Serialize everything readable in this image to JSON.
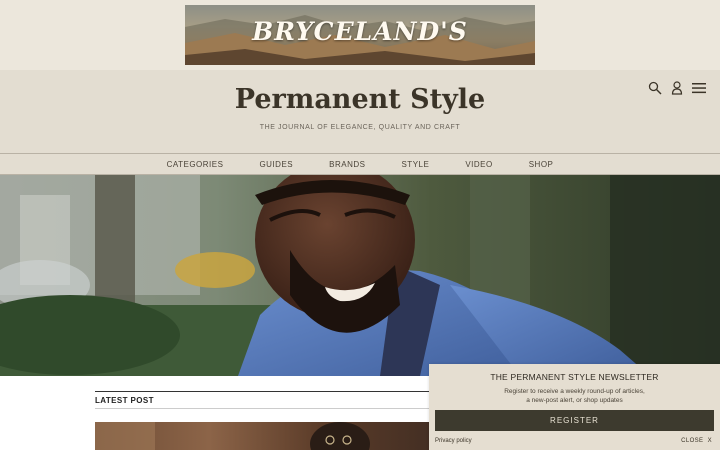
{
  "ad": {
    "brand_logo": "BRYCELAND'S"
  },
  "header": {
    "site_title": "Permanent Style",
    "tagline": "THE JOURNAL OF ELEGANCE, QUALITY AND CRAFT",
    "icons": [
      "search-icon",
      "user-icon",
      "menu-icon"
    ]
  },
  "nav": {
    "items": [
      "CATEGORIES",
      "GUIDES",
      "BRANDS",
      "STYLE",
      "VIDEO",
      "SHOP"
    ]
  },
  "latest": {
    "label": "LATEST POST"
  },
  "newsletter": {
    "title": "THE PERMANENT STYLE NEWSLETTER",
    "desc_line1": "Register to receive a weekly round-up of articles,",
    "desc_line2": "a new-post alert, or shop updates",
    "register_label": "REGISTER",
    "privacy_label": "Privacy policy",
    "close_label": "CLOSE",
    "close_x": "X"
  },
  "colors": {
    "header_bg": "#e3ddd1",
    "title_color": "#3b3428",
    "register_bg": "#3d3a2e",
    "jacket_blue": "#4b6fb0"
  }
}
